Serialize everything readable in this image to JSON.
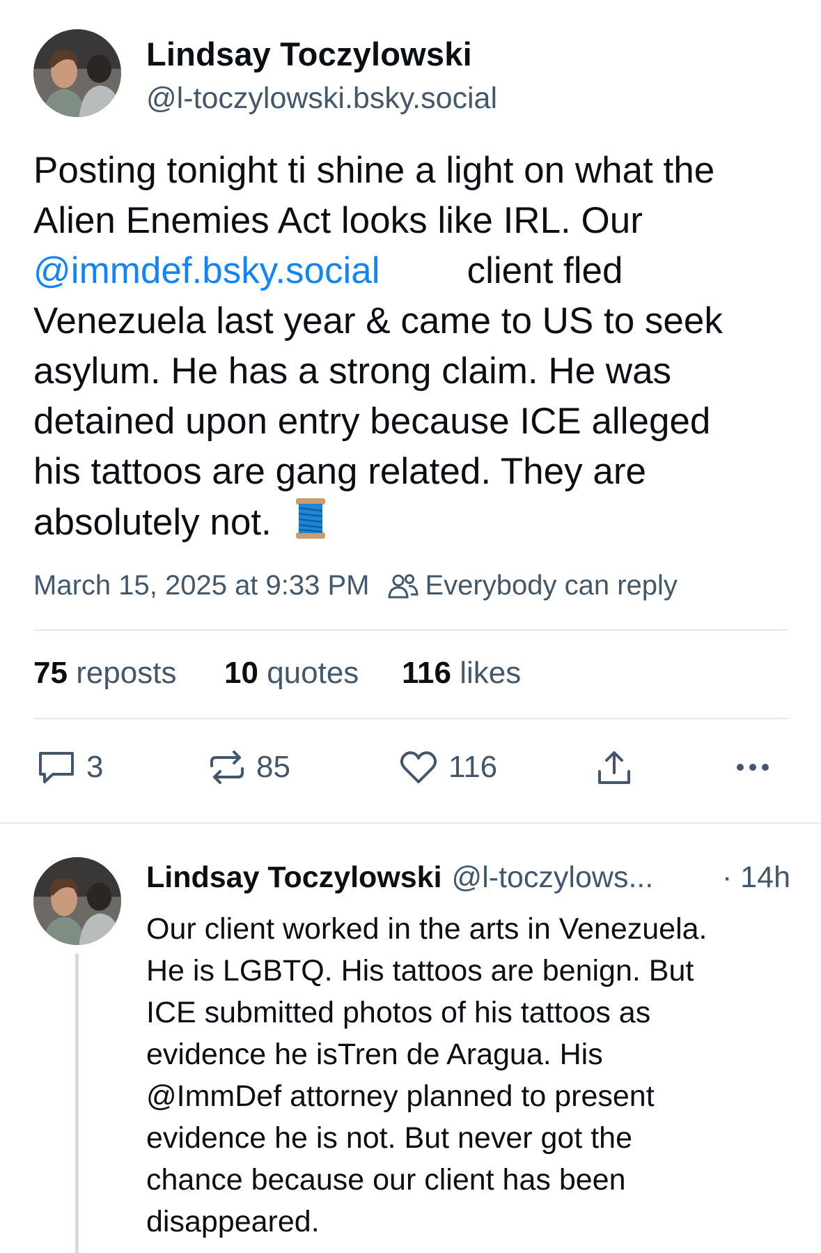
{
  "post": {
    "author_name": "Lindsay Toczylowski",
    "author_handle": "@l-toczylowski.bsky.social",
    "text_line1": "Posting tonight ti shine a light on what the",
    "text_line2": "Alien Enemies Act looks like IRL. Our",
    "mention": "@immdef.bsky.social",
    "text_line3_rest": "client fled",
    "text_line4": "Venezuela last year & came to US to seek",
    "text_line5": "asylum. He has a strong claim. He was",
    "text_line6": "detained upon entry because ICE alleged",
    "text_line7": "his tattoos are gang related. They are",
    "text_line8": "absolutely not.",
    "emoji": "🧵",
    "timestamp": "March 15, 2025 at 9:33 PM",
    "reply_setting": "Everybody can reply"
  },
  "stats": {
    "reposts_count": "75",
    "reposts_label": "reposts",
    "quotes_count": "10",
    "quotes_label": "quotes",
    "likes_count": "116",
    "likes_label": "likes"
  },
  "actions": {
    "reply_count": "3",
    "repost_count": "85",
    "like_count": "116"
  },
  "reply": {
    "author_name": "Lindsay Toczylowski",
    "author_handle": "@l-toczylows...",
    "time": "· 14h",
    "lines": [
      "Our client worked in the arts in Venezuela.",
      "He is LGBTQ. His tattoos are benign. But",
      "ICE submitted photos of his tattoos as",
      "evidence he isTren de Aragua. His",
      "@ImmDef attorney planned to present",
      "evidence he is not. But never got the",
      "chance because our client has been",
      "disappeared."
    ]
  },
  "colors": {
    "text": "#0b0f14",
    "muted": "#42576c",
    "link": "#1083fe",
    "divider": "#e3e8ed"
  },
  "icons": [
    "people-icon",
    "comment-icon",
    "repost-icon",
    "heart-icon",
    "share-icon",
    "more-icon",
    "thread-emoji"
  ]
}
